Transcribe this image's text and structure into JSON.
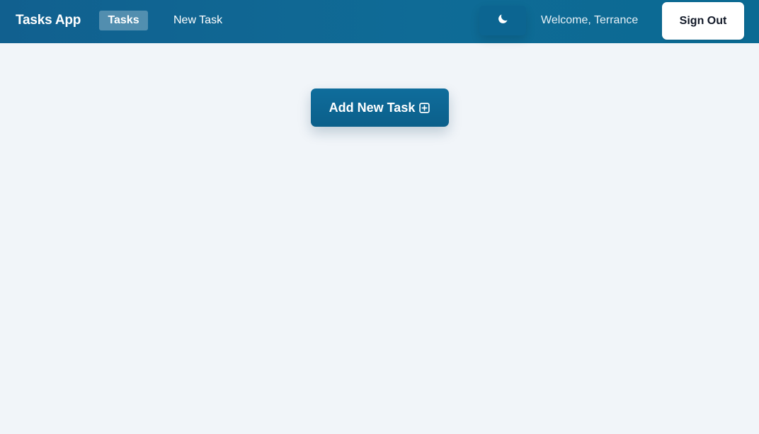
{
  "navbar": {
    "brand": "Tasks App",
    "tabs": [
      {
        "label": "Tasks",
        "active": true
      },
      {
        "label": "New Task",
        "active": false
      }
    ],
    "theme_toggle_icon": "moon-icon",
    "welcome_text": "Welcome, Terrance",
    "signout_label": "Sign Out"
  },
  "main": {
    "add_button_label": "Add New Task",
    "add_button_icon": "plus-square-icon"
  },
  "colors": {
    "navbar": "#0f6b96",
    "primary_button": "#0b5f8a",
    "page_background": "#f1f5f9"
  }
}
